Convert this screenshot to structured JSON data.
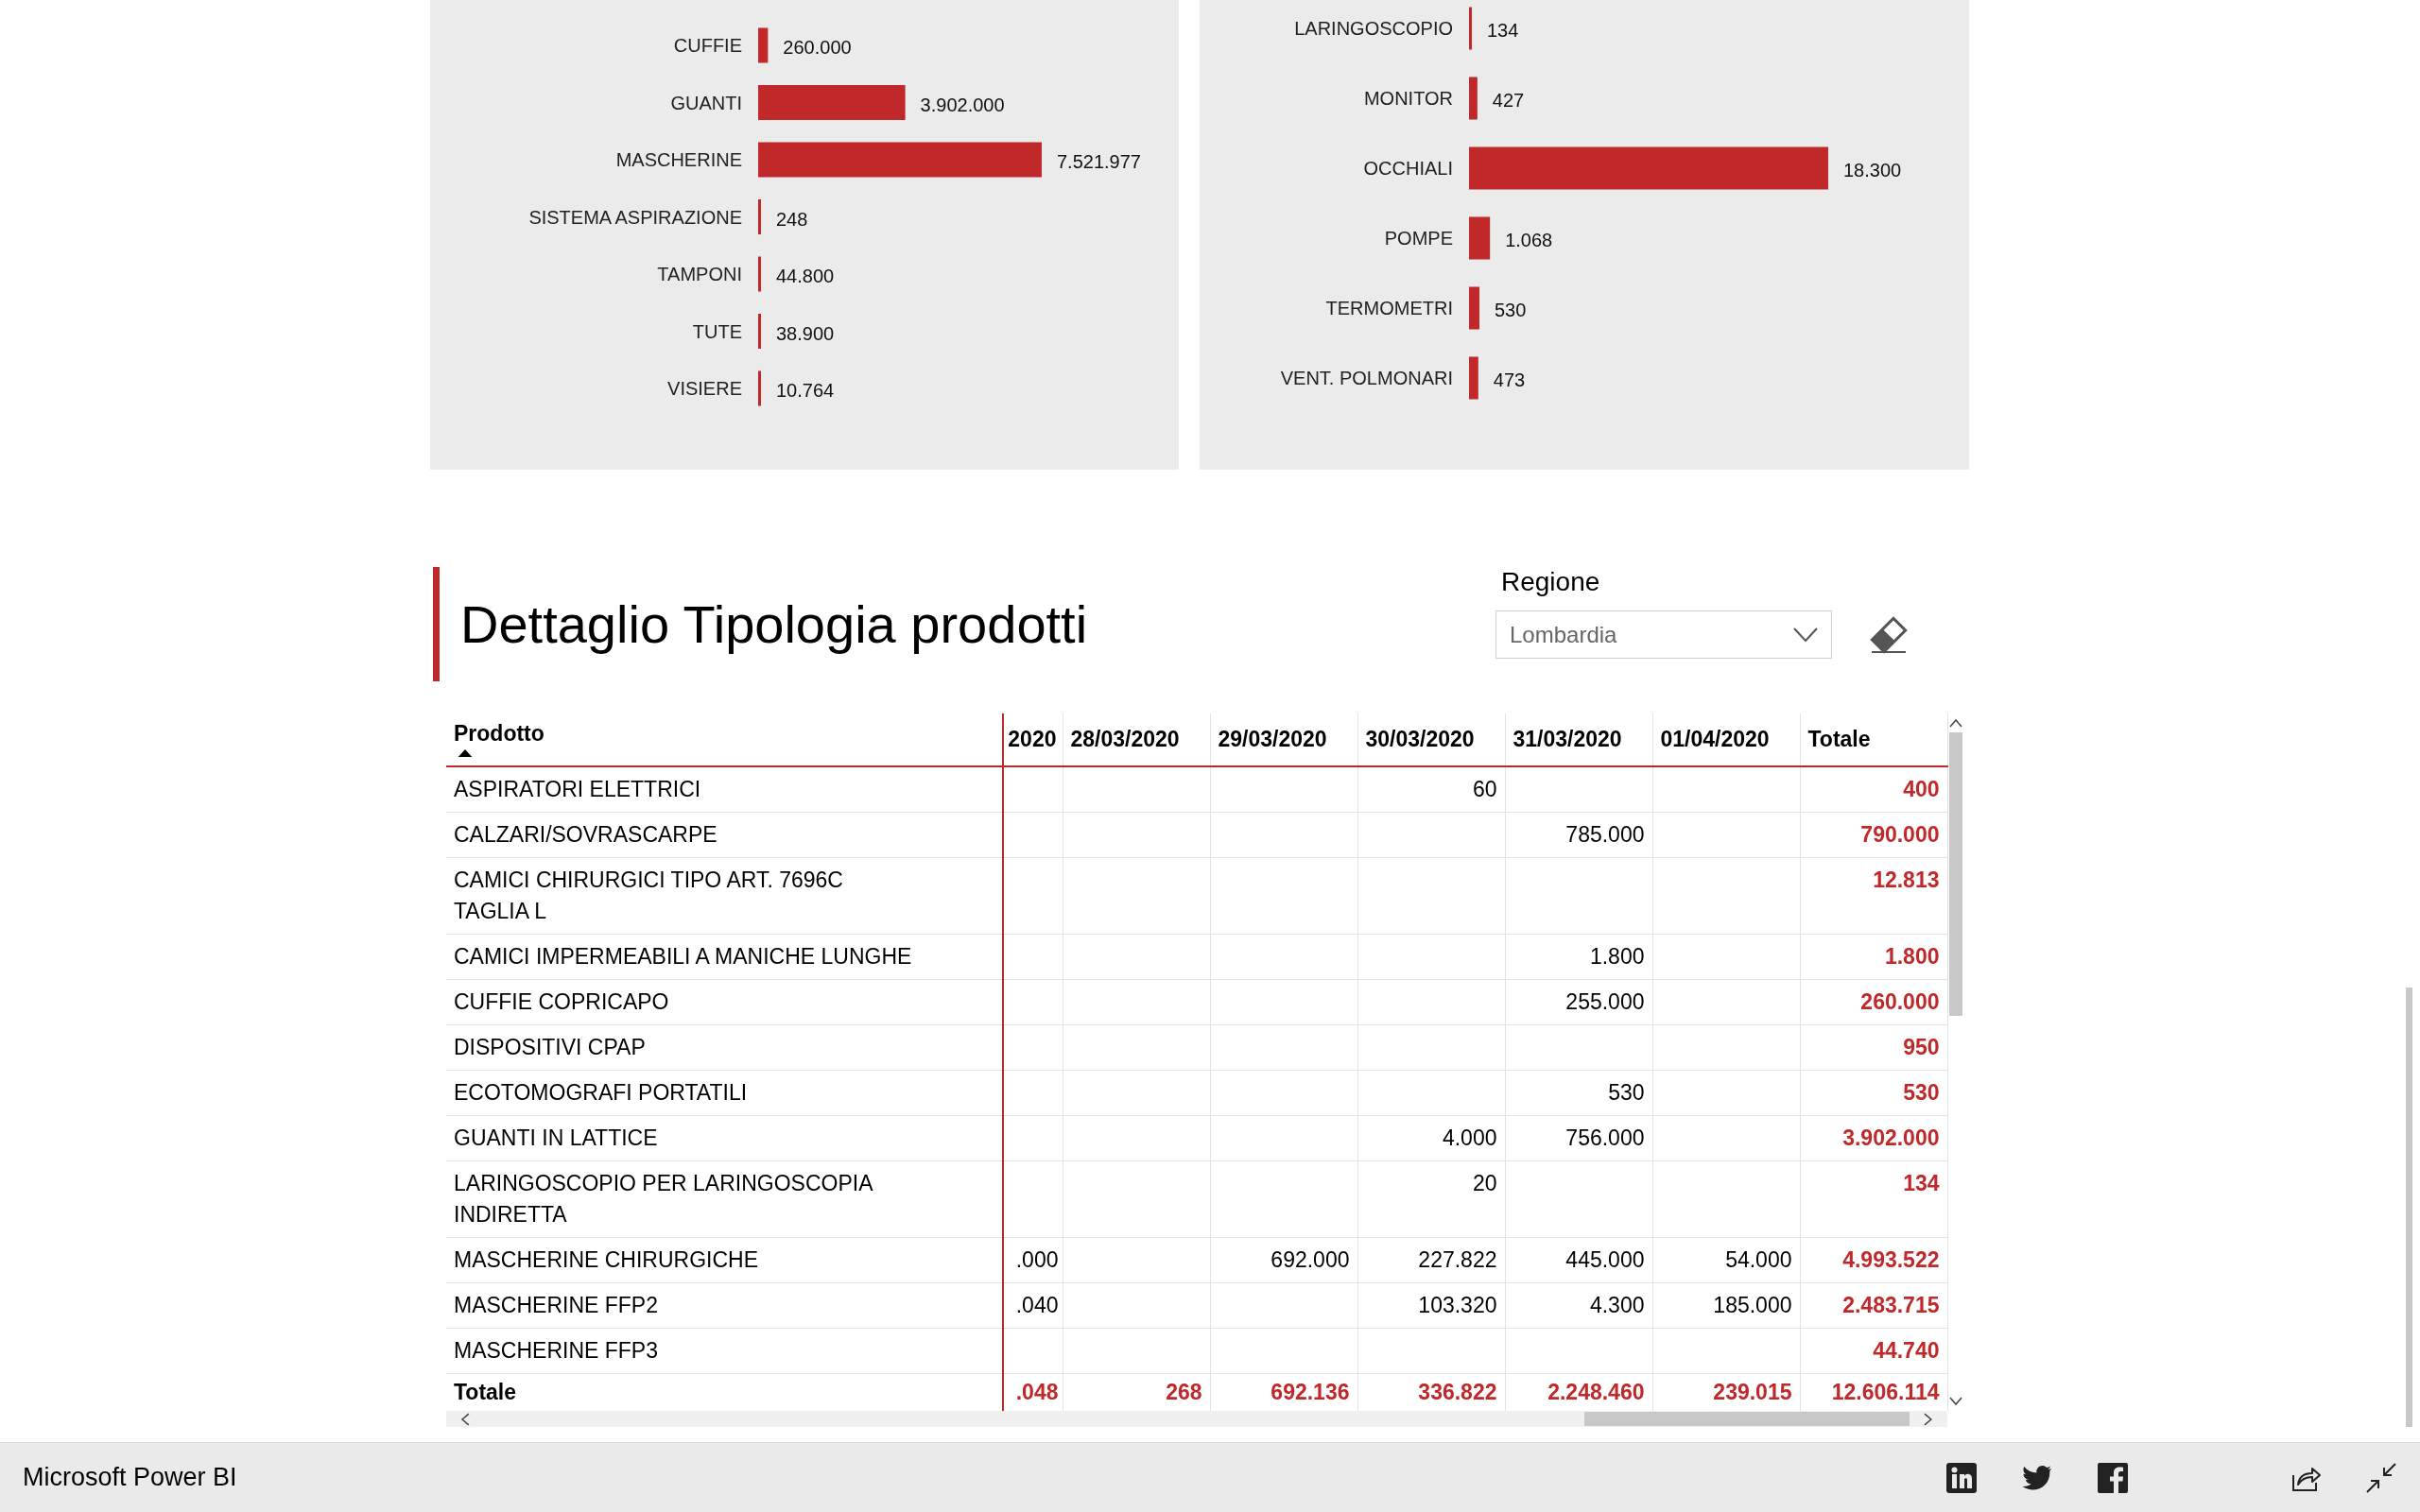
{
  "charts": [
    {
      "chart_data": {
        "type": "bar",
        "orientation": "horizontal",
        "categories": [
          "CUFFIE",
          "GUANTI",
          "MASCHERINE",
          "SISTEMA ASPIRAZIONE",
          "TAMPONI",
          "TUTE",
          "VISIERE"
        ],
        "values": [
          260000,
          3902000,
          7521977,
          248,
          44800,
          38900,
          10764
        ],
        "value_labels": [
          "260.000",
          "3.902.000",
          "7.521.977",
          "248",
          "44.800",
          "38.900",
          "10.764"
        ]
      }
    },
    {
      "chart_data": {
        "type": "bar",
        "orientation": "horizontal",
        "categories": [
          "LARINGOSCOPIO",
          "MONITOR",
          "OCCHIALI",
          "POMPE",
          "TERMOMETRI",
          "VENT. POLMONARI"
        ],
        "values": [
          134,
          427,
          18300,
          1068,
          530,
          473
        ],
        "value_labels": [
          "134",
          "427",
          "18.300",
          "1.068",
          "530",
          "473"
        ]
      }
    }
  ],
  "section": {
    "title": "Dettaglio Tipologia prodotti"
  },
  "slicer": {
    "label": "Regione",
    "value": "Lombardia"
  },
  "table": {
    "product_column": {
      "label": "Prodotto",
      "sorted": true
    },
    "columns": [
      {
        "label": "2020"
      },
      {
        "label": "28/03/2020"
      },
      {
        "label": "29/03/2020"
      },
      {
        "label": "30/03/2020"
      },
      {
        "label": "31/03/2020"
      },
      {
        "label": "01/04/2020"
      },
      {
        "label": "Totale"
      }
    ],
    "rows": [
      {
        "product": "ASPIRATORI ELETTRICI",
        "cells": [
          null,
          null,
          null,
          "60",
          null,
          null,
          "400"
        ]
      },
      {
        "product": "CALZARI/SOVRASCARPE",
        "cells": [
          null,
          null,
          null,
          null,
          "785.000",
          null,
          "790.000"
        ]
      },
      {
        "product": "CAMICI CHIRURGICI TIPO ART. 7696C TAGLIA L",
        "cells": [
          null,
          null,
          null,
          null,
          null,
          null,
          "12.813"
        ]
      },
      {
        "product": "CAMICI IMPERMEABILI A MANICHE LUNGHE",
        "cells": [
          null,
          null,
          null,
          null,
          "1.800",
          null,
          "1.800"
        ]
      },
      {
        "product": "CUFFIE COPRICAPO",
        "cells": [
          null,
          null,
          null,
          null,
          "255.000",
          null,
          "260.000"
        ]
      },
      {
        "product": "DISPOSITIVI CPAP",
        "cells": [
          null,
          null,
          null,
          null,
          null,
          null,
          "950"
        ]
      },
      {
        "product": "ECOTOMOGRAFI PORTATILI",
        "cells": [
          null,
          null,
          null,
          null,
          "530",
          null,
          "530"
        ]
      },
      {
        "product": "GUANTI IN LATTICE",
        "cells": [
          null,
          null,
          null,
          "4.000",
          "756.000",
          null,
          "3.902.000"
        ]
      },
      {
        "product": "LARINGOSCOPIO PER LARINGOSCOPIA INDIRETTA",
        "cells": [
          null,
          null,
          null,
          "20",
          null,
          null,
          "134"
        ]
      },
      {
        "product": "MASCHERINE CHIRURGICHE",
        "cells": [
          ".000",
          null,
          "692.000",
          "227.822",
          "445.000",
          "54.000",
          "4.993.522"
        ]
      },
      {
        "product": "MASCHERINE FFP2",
        "cells": [
          ".040",
          null,
          null,
          "103.320",
          "4.300",
          "185.000",
          "2.483.715"
        ]
      },
      {
        "product": "MASCHERINE FFP3",
        "cells": [
          null,
          null,
          null,
          null,
          null,
          null,
          "44.740"
        ]
      }
    ],
    "total": {
      "label": "Totale",
      "cells": [
        ".048",
        "268",
        "692.136",
        "336.822",
        "2.248.460",
        "239.015",
        "12.606.114"
      ]
    }
  },
  "footer": {
    "brand": "Microsoft Power BI"
  }
}
